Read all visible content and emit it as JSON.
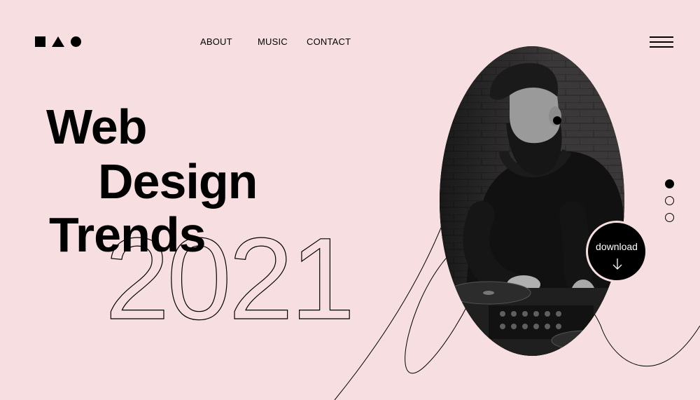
{
  "logo": {
    "shapes": [
      "square",
      "triangle",
      "circle"
    ]
  },
  "nav": {
    "items": [
      {
        "label": "ABOUT"
      },
      {
        "label": "MUSIC"
      },
      {
        "label": "CONTACT"
      }
    ]
  },
  "menu": {
    "icon": "hamburger-menu-icon"
  },
  "hero": {
    "line1": "Web",
    "line2": "Design",
    "line3": "Trends",
    "year": "2021"
  },
  "slider": {
    "count": 3,
    "active_index": 0
  },
  "download": {
    "label": "download",
    "icon": "arrow-down-icon"
  },
  "colors": {
    "background": "#f7dfe1",
    "text": "#000000",
    "button": "#000000",
    "button_text": "#ffffff"
  }
}
